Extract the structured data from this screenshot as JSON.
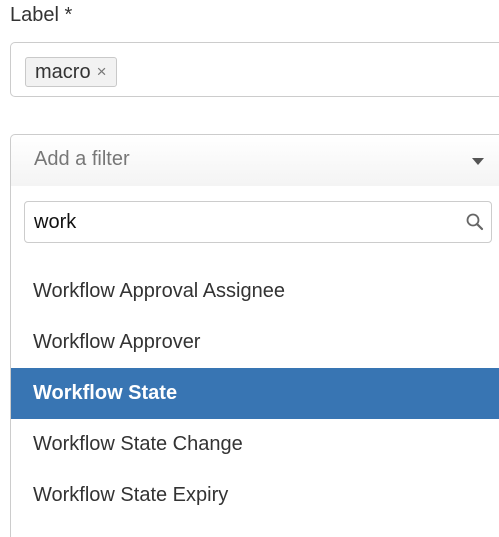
{
  "label_field": {
    "label": "Label *",
    "tags": [
      {
        "text": "macro",
        "remove_symbol": "×"
      }
    ]
  },
  "filter_select": {
    "placeholder": "Add a filter",
    "caret_icon": "chevron-down-icon"
  },
  "dropdown": {
    "search": {
      "value": "work",
      "icon": "search-icon"
    },
    "options": [
      {
        "label": "Workflow Approval Assignee",
        "highlighted": false
      },
      {
        "label": "Workflow Approver",
        "highlighted": false
      },
      {
        "label": "Workflow State",
        "highlighted": true
      },
      {
        "label": "Workflow State Change",
        "highlighted": false
      },
      {
        "label": "Workflow State Expiry",
        "highlighted": false
      }
    ],
    "highlight_color": "#3875b3"
  }
}
